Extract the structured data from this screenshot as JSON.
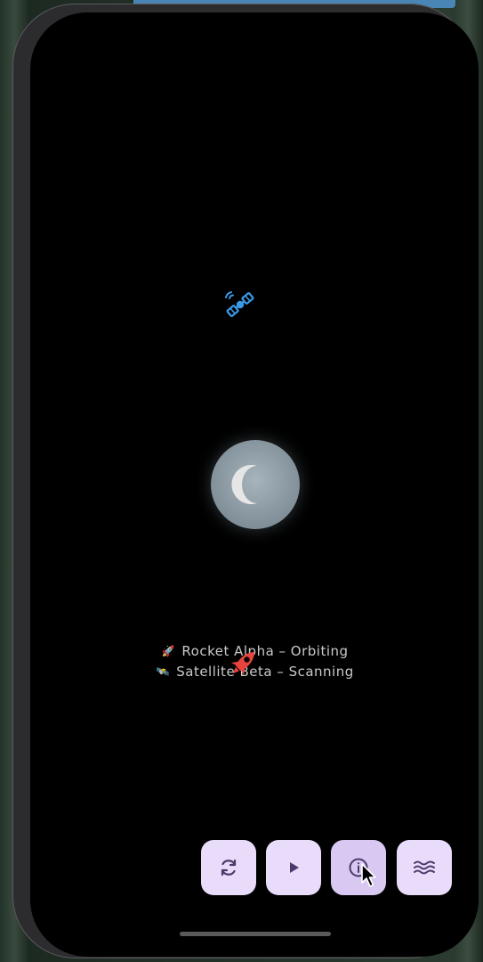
{
  "status": {
    "rocket": {
      "emoji": "🚀",
      "text": "Rocket Alpha – Orbiting"
    },
    "satellite": {
      "emoji": "🛰️",
      "text": "Satellite Beta – Scanning"
    }
  },
  "icons": {
    "satellite": "satellite-icon",
    "moon": "moon-icon",
    "rocket": "rocket-icon",
    "refresh": "refresh-icon",
    "play": "play-icon",
    "info": "info-icon",
    "waves": "waves-icon"
  },
  "colors": {
    "screen_bg": "#000000",
    "fab_bg": "#e9dcfb",
    "fab_active_bg": "#d8c8f2",
    "fab_icon": "#4a3a6a",
    "satellite": "#3b9ae8",
    "rocket": "#e8443f",
    "status_text": "#c9c9cc"
  }
}
